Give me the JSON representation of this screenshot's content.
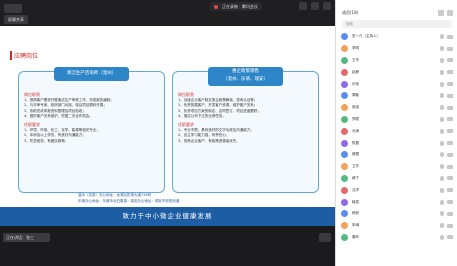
{
  "topbar": {
    "tag_label": "屏幕共享",
    "recording_label": "正在录制 · 腾讯会议",
    "icons": [
      "back-icon",
      "record-dot-icon",
      "minimize-icon",
      "maximize-icon",
      "close-icon"
    ]
  },
  "slide": {
    "title": "应聘岗位",
    "left_panel": {
      "title": "清洁生产咨询师（温州）",
      "duty_heading": "岗位职责",
      "duties": [
        "1、按照客户需求开展清洁生产审核工作，完成报告编制；",
        "2、与评审专家、政府部门对接，保证项目顺利开展；",
        "3、协助完成申报资料整理及项目验收；",
        "4、做好客户关系维护，挖掘二次合作机会。"
      ],
      "req_heading": "任职要求",
      "reqs": [
        "1、环境、环保、化工、化学、能源等相关专业；",
        "2、本科及以上学历，有良好沟通能力；",
        "3、吃苦耐劳，有团队精神。"
      ]
    },
    "right_panel": {
      "title": "惠企政策销售",
      "subtitle": "（温州、乐清、瑞安）",
      "duty_heading": "岗位职责",
      "duties": [
        "1、对接企业客户制定惠企政策解读，咨询认证等；",
        "2、负责拓展客户、开发客户资源，维护客户关系；",
        "3、负责项目方案的制定、合同签订，项目进度跟踪；",
        "4、落实公司下达的业绩任务。"
      ],
      "req_heading": "任职要求",
      "reqs": [
        "1、专业不限，具有良好的文字功底及沟通能力；",
        "2、自主学习能力强，有责任心；",
        "3、熟悉企业客户，有政策资源者优先。"
      ]
    },
    "footnotes": [
      "温州（总部）办公地址：龙湾区机场大道738号",
      "乐清办公地址：乐清市北白象镇  ·  瑞安办公地址：瑞安市安阳街道"
    ],
    "banner": "致力于中小微企业健康发展"
  },
  "bottombar": {
    "speaker_label": "正在讲话：张三"
  },
  "participants": {
    "header": "成员(18)",
    "search_placeholder": "搜索",
    "list": [
      {
        "name": "张一凡（主持人）",
        "color": "#5b8def"
      },
      {
        "name": "李明",
        "color": "#f0a35a"
      },
      {
        "name": "王华",
        "color": "#56b984"
      },
      {
        "name": "赵静",
        "color": "#e56b6b"
      },
      {
        "name": "孙伟",
        "color": "#8f6be5"
      },
      {
        "name": "周敏",
        "color": "#5b8def"
      },
      {
        "name": "吴强",
        "color": "#f0a35a"
      },
      {
        "name": "郑丽",
        "color": "#56b984"
      },
      {
        "name": "冯涛",
        "color": "#e56b6b"
      },
      {
        "name": "陈晨",
        "color": "#8f6be5"
      },
      {
        "name": "褚雪",
        "color": "#5b8def"
      },
      {
        "name": "卫东",
        "color": "#f0a35a"
      },
      {
        "name": "蒋宁",
        "color": "#56b984"
      },
      {
        "name": "沈洋",
        "color": "#e56b6b"
      },
      {
        "name": "韩笑",
        "color": "#8f6be5"
      },
      {
        "name": "杨帆",
        "color": "#5b8def"
      },
      {
        "name": "朱琳",
        "color": "#f0a35a"
      },
      {
        "name": "秦岭",
        "color": "#56b984"
      }
    ]
  }
}
